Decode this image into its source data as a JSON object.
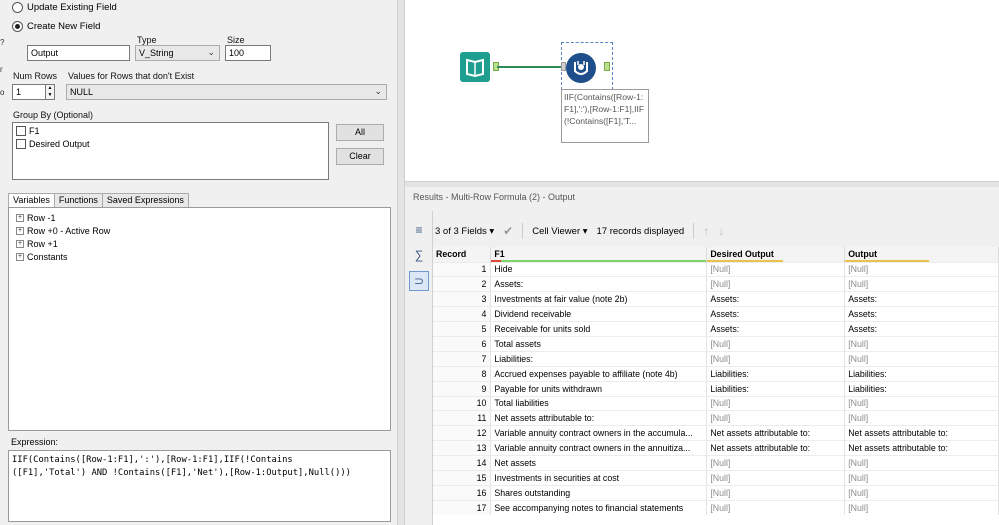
{
  "config": {
    "radio_update": "Update Existing Field",
    "radio_create": "Create New  Field",
    "type_label": "Type",
    "size_label": "Size",
    "field_name": "Output",
    "field_type": "V_String",
    "field_size": "100",
    "num_rows_label": "Num Rows",
    "num_rows_value": "1",
    "values_label": "Values for Rows that don't Exist",
    "values_select": "NULL",
    "group_by_label": "Group By (Optional)",
    "group_by_items": [
      "F1",
      "Desired Output"
    ],
    "all_button": "All",
    "clear_button": "Clear"
  },
  "tabs": [
    "Variables",
    "Functions",
    "Saved Expressions"
  ],
  "variables": [
    "Row -1",
    "Row +0 - Active Row",
    "Row +1",
    "Constants"
  ],
  "expression_label": "Expression:",
  "expression": "IIF(Contains([Row-1:F1],':'),[Row-1:F1],IIF(!Contains\n([F1],'Total') AND !Contains([F1],'Net'),[Row-1:Output],Null()))",
  "canvas": {
    "annotation": "IIF(Contains([Row-1:F1],':'),[Row-1:F1],IIF(!Contains([F1],'T..."
  },
  "results": {
    "title": "Results - Multi-Row Formula (2) - Output",
    "fields_selector": "3 of 3 Fields",
    "cell_viewer": "Cell Viewer",
    "records_displayed": "17 records displayed",
    "columns": [
      "Record",
      "F1",
      "Desired Output",
      "Output"
    ],
    "rows": [
      [
        "1",
        "Hide",
        "[Null]",
        "[Null]"
      ],
      [
        "2",
        "Assets:",
        "[Null]",
        "[Null]"
      ],
      [
        "3",
        "Investments at fair value (note 2b)",
        "Assets:",
        "Assets:"
      ],
      [
        "4",
        "Dividend receivable",
        "Assets:",
        "Assets:"
      ],
      [
        "5",
        "Receivable for units sold",
        "Assets:",
        "Assets:"
      ],
      [
        "6",
        "Total assets",
        "[Null]",
        "[Null]"
      ],
      [
        "7",
        "Liabilities:",
        "[Null]",
        "[Null]"
      ],
      [
        "8",
        "Accrued expenses payable to affiliate (note 4b)",
        "Liabilities:",
        "Liabilities:"
      ],
      [
        "9",
        "Payable for units withdrawn",
        "Liabilities:",
        "Liabilities:"
      ],
      [
        "10",
        "Total liabilities",
        "[Null]",
        "[Null]"
      ],
      [
        "11",
        "Net assets attributable to:",
        "[Null]",
        "[Null]"
      ],
      [
        "12",
        "Variable annuity contract owners in the accumula...",
        "Net assets attributable to:",
        "Net assets attributable to:"
      ],
      [
        "13",
        "Variable annuity contract owners in the annuitiza...",
        "Net assets attributable to:",
        "Net assets attributable to:"
      ],
      [
        "14",
        "Net assets",
        "[Null]",
        "[Null]"
      ],
      [
        "15",
        "Investments in securities at cost",
        "[Null]",
        "[Null]"
      ],
      [
        "16",
        "Shares outstanding",
        "[Null]",
        "[Null]"
      ],
      [
        "17",
        "See accompanying notes to financial statements",
        "[Null]",
        "[Null]"
      ]
    ]
  },
  "colors": {
    "input_tool": "#1d9e8e",
    "formula_tool": "#1f4e8c",
    "connection": "#2e8b57",
    "quality_good": "#7ed36b",
    "quality_mixed": "#e9c24a",
    "quality_bad": "#e0463c"
  }
}
